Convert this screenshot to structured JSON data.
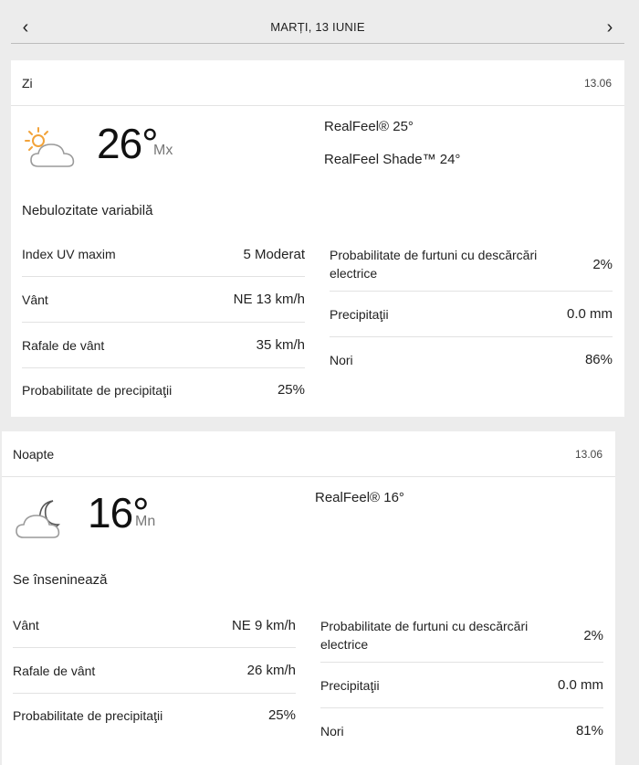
{
  "nav": {
    "date": "MARȚI, 13 IUNIE",
    "prev_glyph": "‹",
    "next_glyph": "›"
  },
  "day": {
    "label": "Zi",
    "date": "13.06",
    "icon": "partly-sunny-icon",
    "temp": "26°",
    "temp_unit": "Mx",
    "realfeel": "RealFeel® 25°",
    "realfeel_shade": "RealFeel Shade™ 24°",
    "phrase": "Nebulozitate variabilă",
    "left": [
      {
        "label": "Index UV maxim",
        "value": "5 Moderat"
      },
      {
        "label": "Vânt",
        "value": "NE 13 km/h"
      },
      {
        "label": "Rafale de vânt",
        "value": "35 km/h"
      },
      {
        "label": "Probabilitate de precipitaţii",
        "value": "25%"
      }
    ],
    "right": [
      {
        "label": "Probabilitate de furtuni cu descărcări electrice",
        "value": "2%"
      },
      {
        "label": "Precipitaţii",
        "value": "0.0 mm"
      },
      {
        "label": "Nori",
        "value": "86%"
      }
    ]
  },
  "night": {
    "label": "Noapte",
    "date": "13.06",
    "icon": "cloudy-moon-icon",
    "temp": "16°",
    "temp_unit": "Mn",
    "realfeel": "RealFeel® 16°",
    "phrase": "Se înseninează",
    "left": [
      {
        "label": "Vânt",
        "value": "NE 9 km/h"
      },
      {
        "label": "Rafale de vânt",
        "value": "26 km/h"
      },
      {
        "label": "Probabilitate de precipitaţii",
        "value": "25%"
      }
    ],
    "right": [
      {
        "label": "Probabilitate de furtuni cu descărcări electrice",
        "value": "2%"
      },
      {
        "label": "Precipitaţii",
        "value": "0.0 mm"
      },
      {
        "label": "Nori",
        "value": "81%"
      }
    ]
  }
}
